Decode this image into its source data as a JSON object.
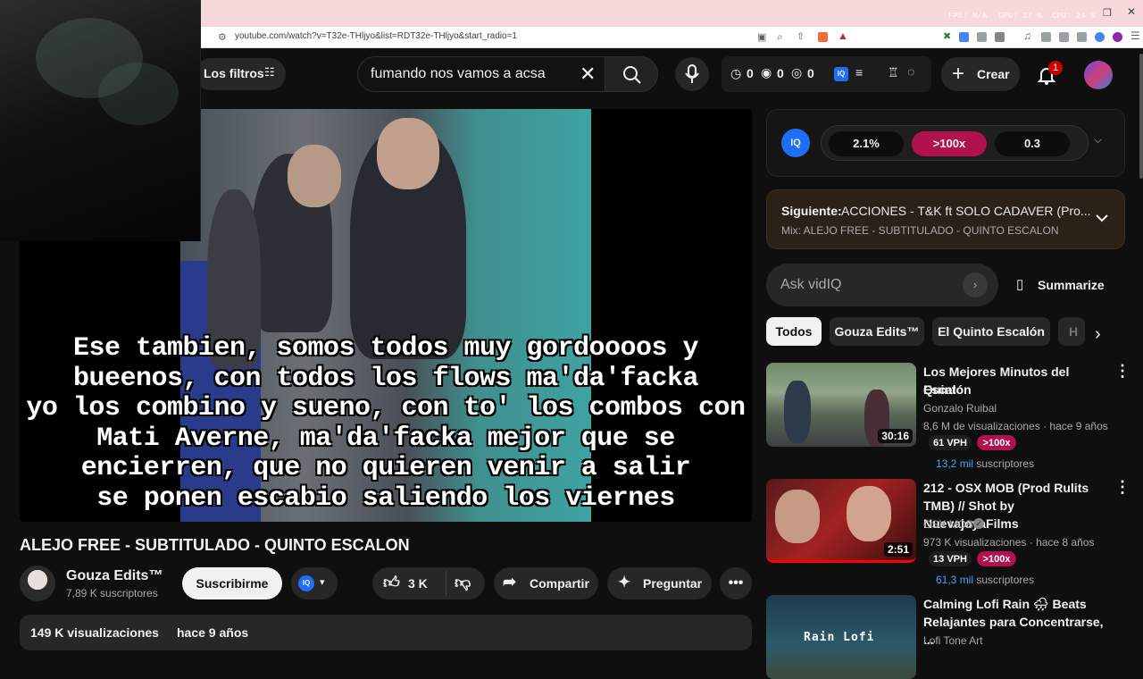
{
  "browser": {
    "url": "youtube.com/watch?v=T32e-THljyo&list=RDT32e-THljyo&start_radio=1",
    "overlay_stats": [
      "FPS: N/A",
      "GPU: 37 %",
      "CPU: 24 %"
    ]
  },
  "header": {
    "filters_label": "Los filtros",
    "search_value": "fumando nos vamos a acsa",
    "stats": [
      "0",
      "0",
      "0"
    ],
    "create_label": "Crear",
    "notification_count": "1"
  },
  "video": {
    "subtitle_lines": [
      "Ese tambien, somos todos muy gordoooos y",
      "bueenos, con todos los flows ma'da'facka",
      "yo los combino y sueno, con to' los combos con",
      "Mati Averne, ma'da'facka mejor que se",
      "encierren, que no quieren venir a salir",
      "se ponen escabio saliendo los viernes"
    ],
    "title": "ALEJO FREE - SUBTITULADO - QUINTO ESCALON",
    "channel": "Gouza Edits™",
    "subscribers": "7,89 K suscriptores",
    "subscribe_label": "Suscribirme",
    "likes": "3 K",
    "share_label": "Compartir",
    "ask_label": "Preguntar",
    "views_line": "149 K visualizaciones",
    "age_line": "hace 9 años"
  },
  "vidiq": {
    "metrics": [
      "2.1%",
      ">100x",
      "0.3"
    ],
    "next_label": "Siguiente:",
    "next_title": "ACCIONES - T&K ft SOLO CADAVER (Pro...",
    "mix_label": "Mix: ALEJO FREE - SUBTITULADO - QUINTO ESCALON",
    "ask_placeholder": "Ask vidIQ",
    "summarize_label": "Summarize"
  },
  "chips": [
    "Todos",
    "Gouza Edits™",
    "El Quinto Escalón",
    "H"
  ],
  "recommendations": [
    {
      "title_line1": "Los Mejores Minutos del Quinto",
      "title_line2": "Escalón",
      "channel": "Gonzalo Ruibal",
      "stats": "8,6 M de visualizaciones · hace 9 años",
      "duration": "30:16",
      "vph": "61 VPH",
      "multiplier": ">100x",
      "subs_num": "13,2 mil",
      "subs_word": "suscriptores"
    },
    {
      "title_line1": "212 - OSX MOB (Prod Rulits",
      "title_line2": "TMB) // Shot by NuevajoyaFilms",
      "channel": "OSX MOB",
      "stats": "973 K visualizaciones · hace 8 años",
      "duration": "2:51",
      "vph": "13 VPH",
      "multiplier": ">100x",
      "subs_num": "61,3 mil",
      "subs_word": "suscriptores"
    },
    {
      "title_line1": "Calming Lofi Rain 🌧 Beats",
      "title_line2": "Relajantes para Concentrarse, ...",
      "channel": "Lofi Tone Art",
      "thumb_text": "Rain Lofi"
    }
  ]
}
